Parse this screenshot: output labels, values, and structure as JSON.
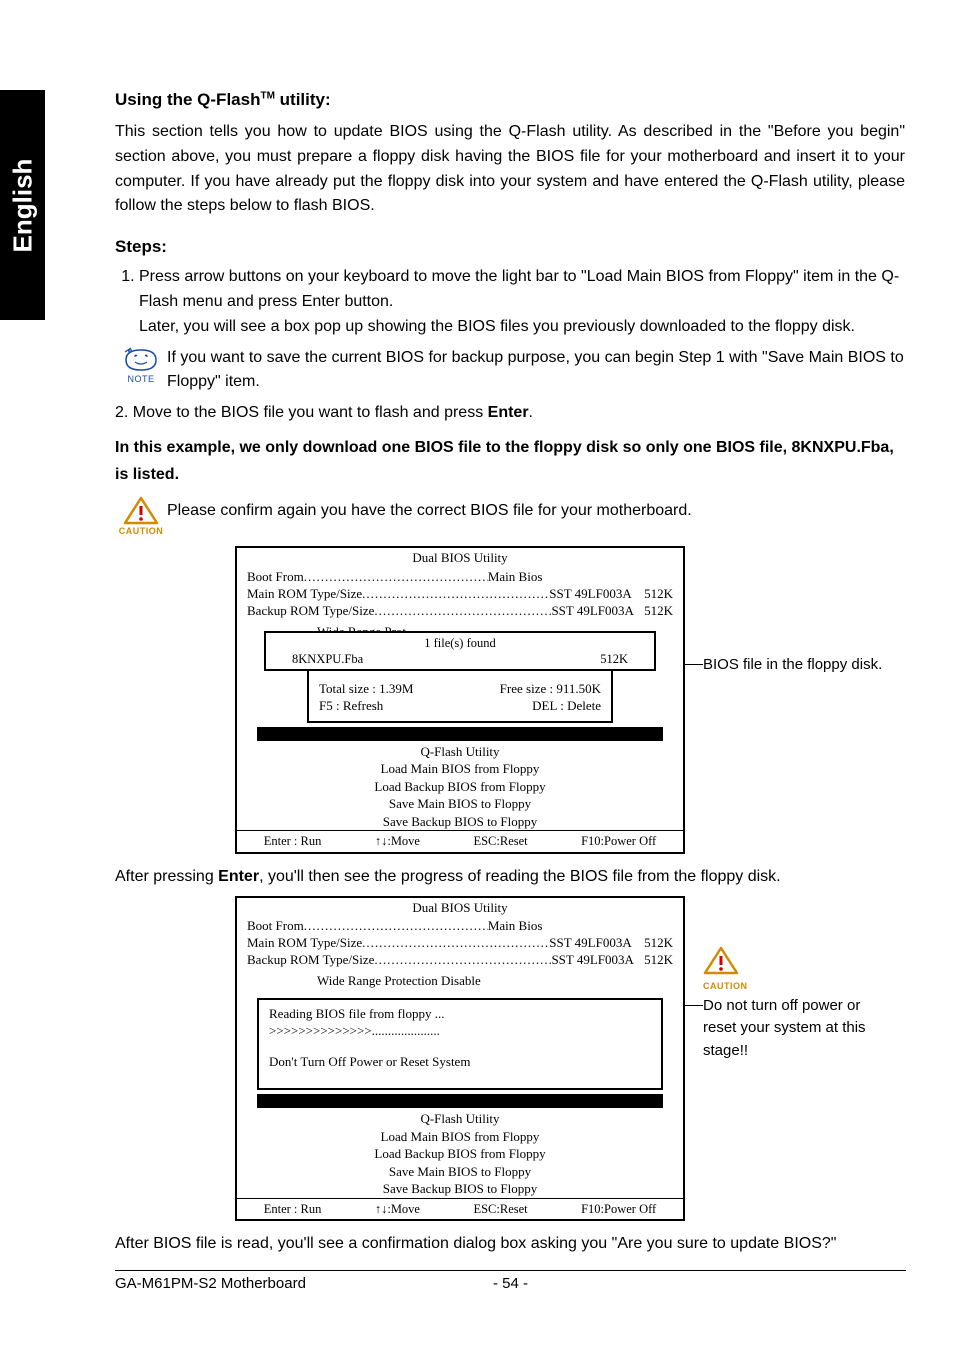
{
  "sideTab": "English",
  "heading1": "Using the Q-Flash",
  "heading1_tm": "TM",
  "heading1_tail": " utility:",
  "intro": "This section tells you how to update BIOS using the Q-Flash utility. As described in the \"Before you begin\" section above, you must prepare a floppy disk having the BIOS file for your motherboard and insert it to your computer. If you have already put the floppy disk into your system and have entered the Q-Flash utility, please follow the steps below to flash BIOS.",
  "stepsLabel": "Steps:",
  "step1a": "Press arrow buttons on your keyboard to move the light bar to \"Load Main BIOS from Floppy\" item in the Q-Flash menu and press Enter button.",
  "step1b": "Later, you will see a box pop up showing the BIOS files you previously downloaded to the floppy disk.",
  "noteLabel": "NOTE",
  "noteText": "If you want to save the current BIOS for backup purpose, you can begin Step 1 with \"Save Main BIOS to Floppy\" item.",
  "step2_pre": "2. Move to the BIOS file you want to flash and press ",
  "enter": "Enter",
  "step2_post": ".",
  "emph": "In this example, we only download one BIOS file to the floppy disk so only one BIOS file, 8KNXPU.Fba, is listed.",
  "cautionLabel": "CAUTION",
  "caution1": "Please confirm again you have the correct BIOS file for your motherboard.",
  "bios": {
    "title": "Dual BIOS Utility",
    "bootFromL": "Boot From",
    "bootFromM": "Main Bios",
    "mainRomL": "Main ROM Type/Size",
    "mainRomM": "SST 49LF003A",
    "mainRomR": "512K",
    "backupRomL": "Backup ROM Type/Size",
    "backupRomM": "SST 49LF003A",
    "backupRomR": "512K",
    "wideLabelCut": "Wide Range Prot",
    "wideLabelFull": "Wide Range Protection     Disable",
    "popupTitle": "1 file(s) found",
    "popupFile": "8KNXPU.Fba",
    "popupSize": "512K",
    "popupTotal": "Total size : 1.39M",
    "popupFree": "Free size : 911.50K",
    "popupF5": "F5 : Refresh",
    "popupDel": "DEL : Delete",
    "reading": "Reading BIOS file from floppy ...",
    "progress": ">>>>>>>>>>>>>>",
    "progressDots": ".....................",
    "warn": "Don't Turn Off Power or Reset System",
    "qflash": "Q-Flash Utility",
    "m1": "Load Main BIOS from Floppy",
    "m2": "Load Backup BIOS from Floppy",
    "m3": "Save Main BIOS to Floppy",
    "m4": "Save Backup BIOS to Floppy",
    "foot1": "Enter : Run",
    "foot2": "↑↓:Move",
    "foot3": "ESC:Reset",
    "foot4": "F10:Power Off"
  },
  "callout1": "BIOS file in the floppy disk.",
  "after1_pre": "After pressing ",
  "after1_post": ", you'll then see the progress of reading the BIOS file from the floppy disk.",
  "callout2": "Do not turn off power or reset your system at this stage!!",
  "after2": "After BIOS file is read, you'll see a confirmation dialog box asking you \"Are you sure to update BIOS?\"",
  "footerLeft": "GA-M61PM-S2 Motherboard",
  "footerMid": "- 54 -"
}
